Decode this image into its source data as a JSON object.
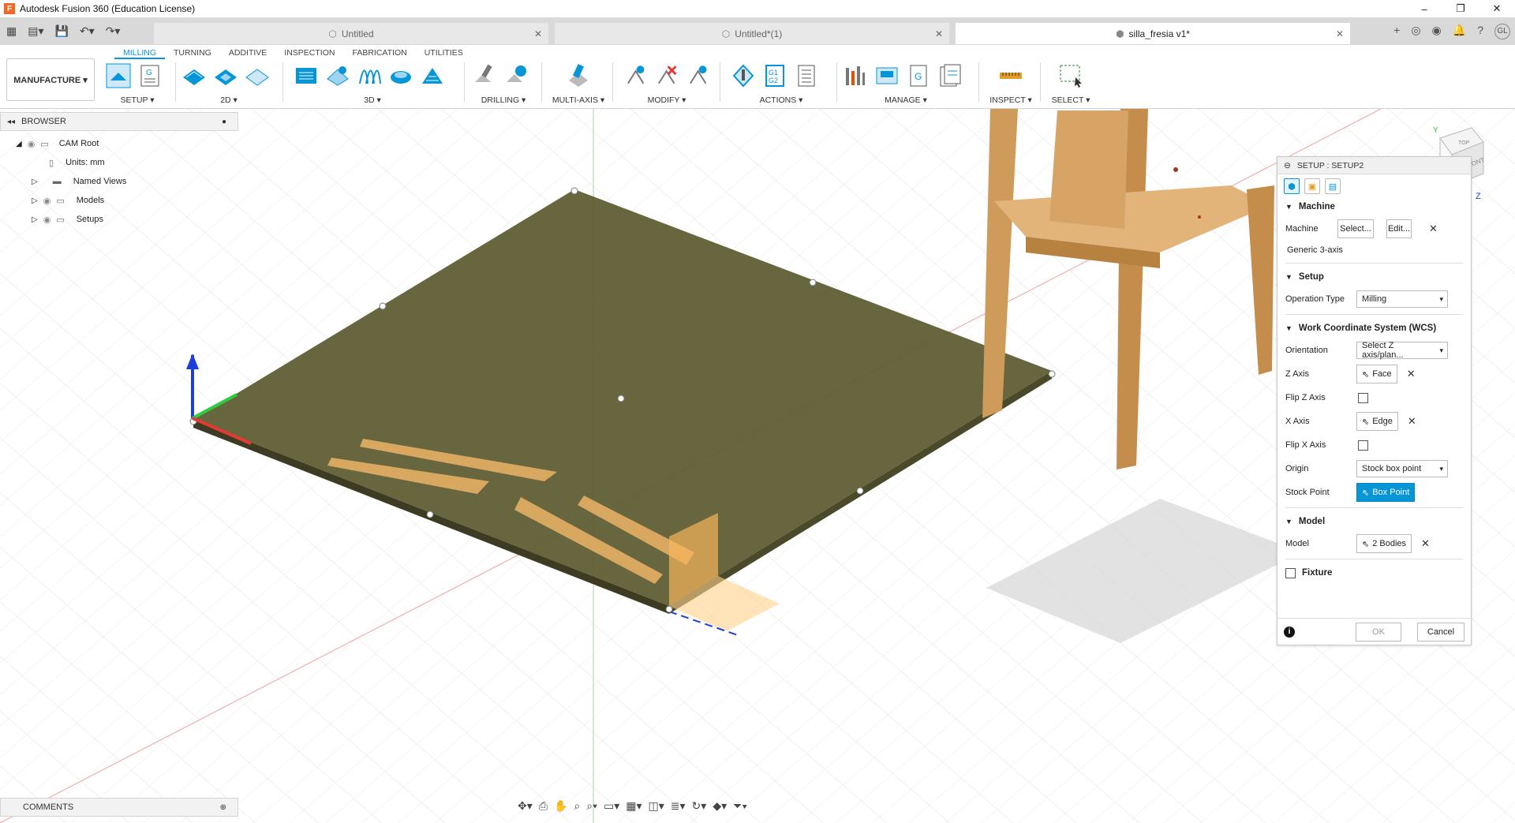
{
  "app": {
    "title": "Autodesk Fusion 360 (Education License)"
  },
  "window": {
    "minimize": "–",
    "restore": "❐",
    "close": "✕"
  },
  "tabs": [
    {
      "label": "Untitled"
    },
    {
      "label": "Untitled*(1)"
    },
    {
      "label": "silla_fresia v1*"
    }
  ],
  "ribbon": {
    "workspace": "MANUFACTURE ▾",
    "tabs": [
      "MILLING",
      "TURNING",
      "ADDITIVE",
      "INSPECTION",
      "FABRICATION",
      "UTILITIES"
    ],
    "groups": {
      "setup": "SETUP ▾",
      "2d": "2D ▾",
      "3d": "3D ▾",
      "drilling": "DRILLING ▾",
      "multiaxis": "MULTI-AXIS ▾",
      "modify": "MODIFY ▾",
      "actions": "ACTIONS ▾",
      "manage": "MANAGE ▾",
      "inspect": "INSPECT ▾",
      "select": "SELECT ▾"
    }
  },
  "browser": {
    "title": "BROWSER",
    "items": [
      {
        "label": "CAM Root"
      },
      {
        "label": "Units: mm"
      },
      {
        "label": "Named Views"
      },
      {
        "label": "Models"
      },
      {
        "label": "Setups"
      }
    ]
  },
  "comments": {
    "title": "COMMENTS"
  },
  "viewcube": {
    "front": "FRONT",
    "top": "TOP",
    "z": "Z",
    "y": "Y"
  },
  "triad": {
    "z": "Z",
    "y": "Y",
    "x": "X"
  },
  "panel": {
    "title": "SETUP : SETUP2",
    "machine": {
      "section": "Machine",
      "label": "Machine",
      "select_btn": "Select...",
      "edit_btn": "Edit...",
      "machine_name": "Generic 3-axis"
    },
    "setup": {
      "section": "Setup",
      "op_type_label": "Operation Type",
      "op_type_value": "Milling"
    },
    "wcs": {
      "section": "Work Coordinate System (WCS)",
      "orientation_label": "Orientation",
      "orientation_value": "Select Z axis/plan...",
      "z_axis_label": "Z Axis",
      "z_axis_value": "Face",
      "flip_z_label": "Flip Z Axis",
      "x_axis_label": "X Axis",
      "x_axis_value": "Edge",
      "flip_x_label": "Flip X Axis",
      "origin_label": "Origin",
      "origin_value": "Stock box point",
      "stock_point_label": "Stock Point",
      "stock_point_value": "Box Point"
    },
    "model": {
      "section": "Model",
      "label": "Model",
      "value": "2 Bodies"
    },
    "fixture": {
      "section": "Fixture"
    },
    "ok": "OK",
    "cancel": "Cancel"
  },
  "colors": {
    "accent": "#0696d7",
    "sheet": "#5f5e34",
    "wood": "#d9a860"
  }
}
